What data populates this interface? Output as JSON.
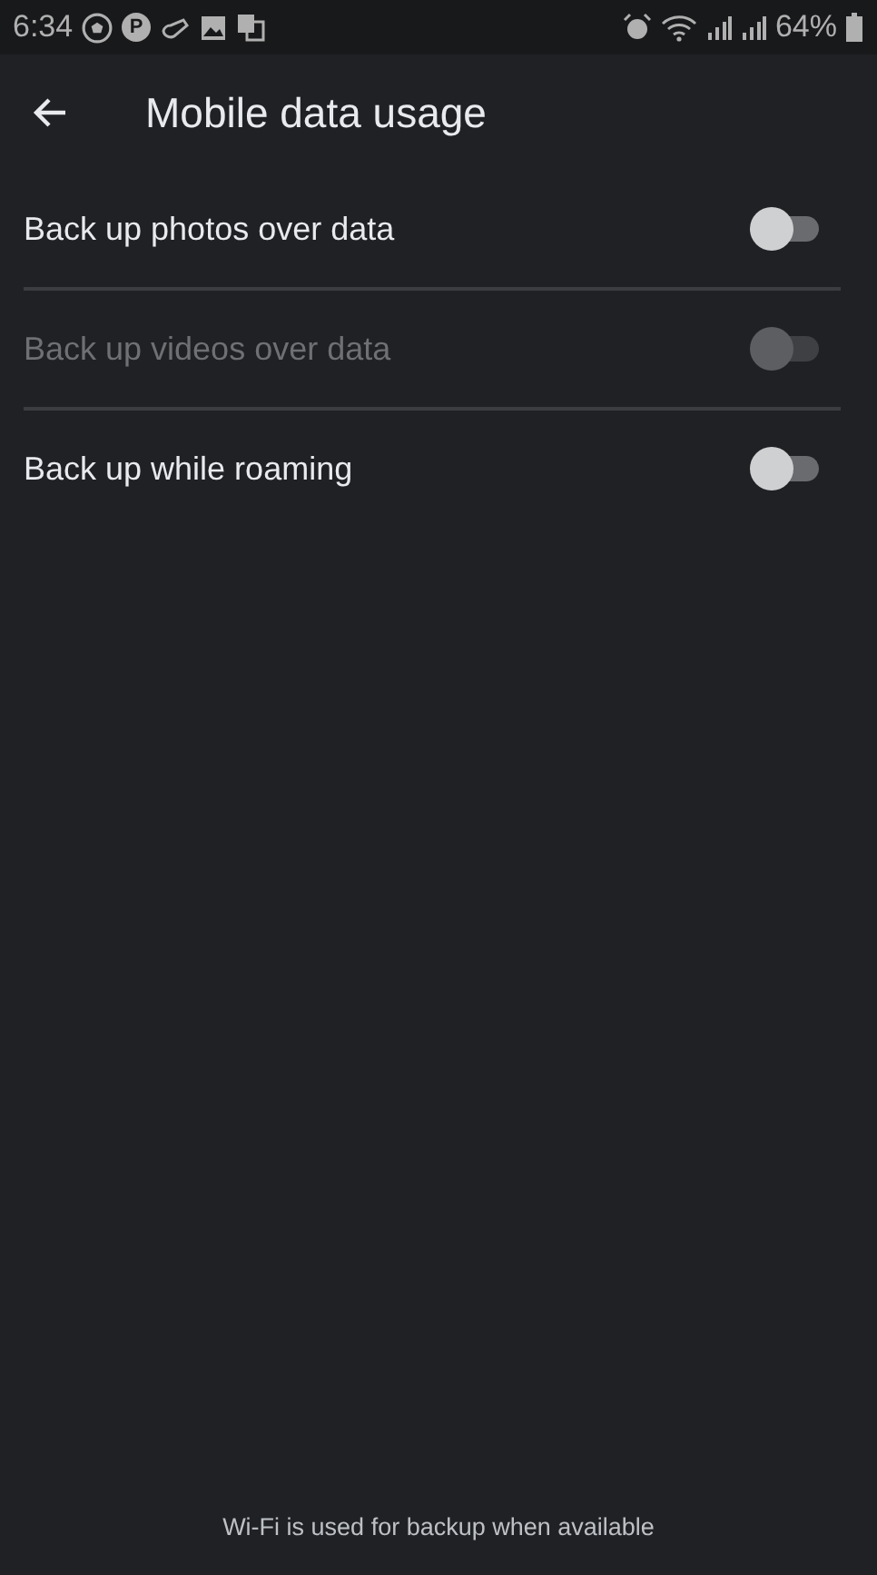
{
  "status_bar": {
    "time": "6:34",
    "parking_badge": "P",
    "battery": "64%"
  },
  "app_bar": {
    "title": "Mobile data usage"
  },
  "settings": [
    {
      "label": "Back up photos over data",
      "on": false,
      "disabled": false
    },
    {
      "label": "Back up videos over data",
      "on": false,
      "disabled": true
    },
    {
      "label": "Back up while roaming",
      "on": false,
      "disabled": false
    }
  ],
  "footer": "Wi‑Fi is used for backup when available"
}
